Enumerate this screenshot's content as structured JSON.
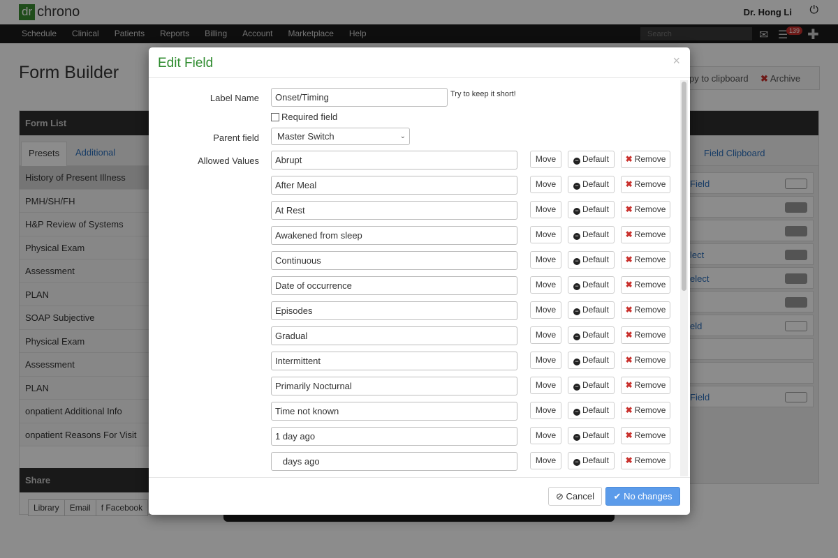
{
  "app": {
    "logo_dr": "dr",
    "logo_chrono": "chrono",
    "doctor_name": "Dr. Hong Li"
  },
  "nav": {
    "items": [
      "Schedule",
      "Clinical",
      "Patients",
      "Reports",
      "Billing",
      "Account",
      "Marketplace",
      "Help"
    ],
    "search_placeholder": "Search",
    "notifications": "139"
  },
  "page": {
    "title": "Form Builder",
    "copy_label": "py to clipboard",
    "archive_label": "Archive"
  },
  "form_list": {
    "header": "Form List",
    "tabs": [
      "Presets",
      "Additional"
    ],
    "items": [
      "History of Present Illness",
      "PMH/SH/FH",
      "H&P Review of Systems",
      "Physical Exam",
      "Assessment",
      "PLAN",
      "SOAP Subjective",
      "Physical Exam",
      "Assessment",
      "PLAN",
      "onpatient Additional Info",
      "onpatient Reasons For Visit"
    ],
    "selected": "History of Present Illness"
  },
  "share": {
    "header": "Share",
    "buttons": [
      "Library",
      "Email",
      "Facebook"
    ]
  },
  "right_panel": {
    "tab": "Field Clipboard",
    "rows": [
      "Field",
      "",
      "",
      "lect",
      "elect",
      "",
      "eld",
      "",
      "",
      "Field"
    ]
  },
  "modal": {
    "title": "Edit Field",
    "close": "×",
    "label_name_label": "Label Name",
    "label_name_value": "Onset/Timing",
    "hint": "Try to keep it short!",
    "required_label": "Required field",
    "parent_label": "Parent field",
    "parent_value": "Master Switch",
    "allowed_label": "Allowed Values",
    "values": [
      "Abrupt",
      "After Meal",
      "At Rest",
      "Awakened from sleep",
      "Continuous",
      "Date of occurrence",
      "Episodes",
      "Gradual",
      "Intermittent",
      "Primarily Nocturnal",
      "Time not known",
      "1 day ago",
      "   days ago"
    ],
    "move_label": "Move",
    "default_label": "Default",
    "remove_label": "Remove",
    "cancel_label": "Cancel",
    "save_label": "No changes"
  }
}
